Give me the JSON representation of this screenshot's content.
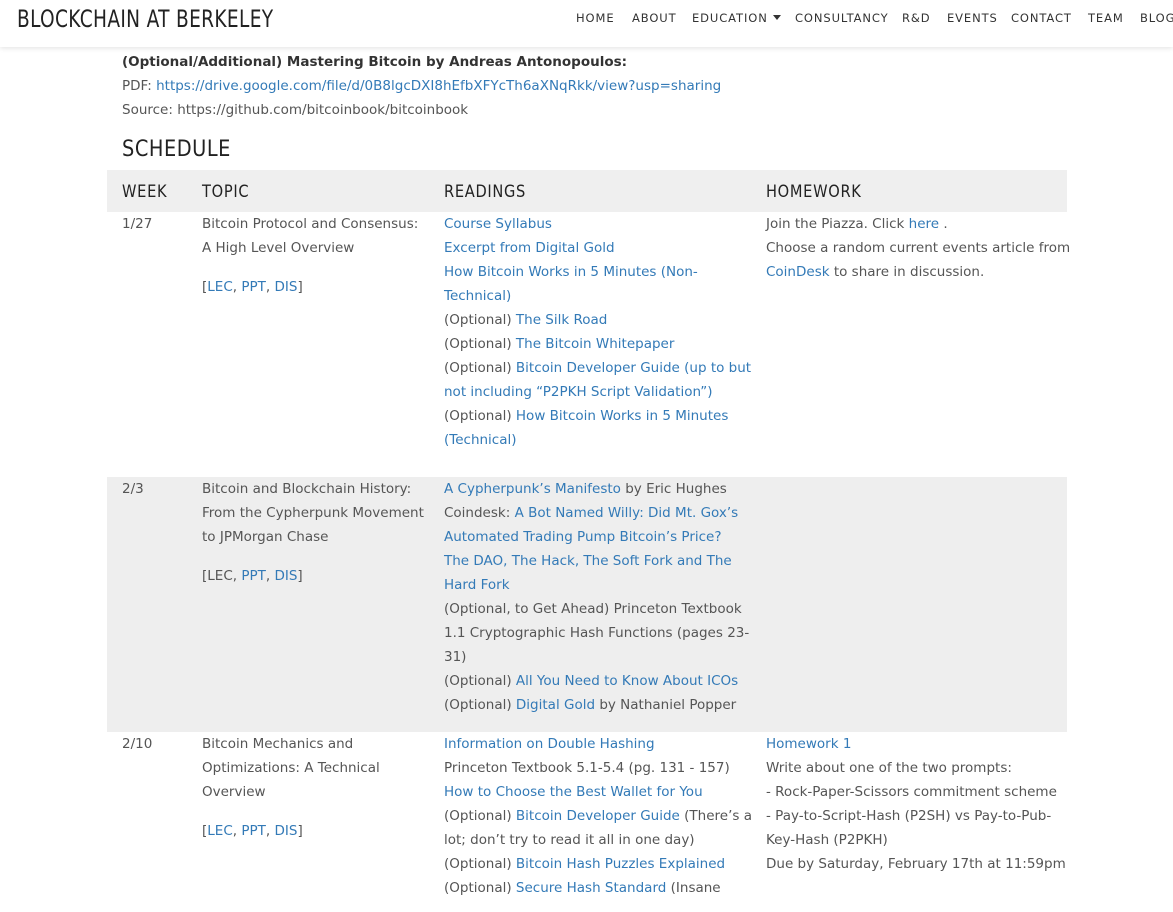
{
  "site": {
    "brand": "BLOCKCHAIN AT BERKELEY",
    "nav": [
      "HOME",
      "ABOUT",
      "EDUCATION",
      "CONSULTANCY",
      "R&D",
      "EVENTS",
      "CONTACT",
      "TEAM",
      "BLOG"
    ]
  },
  "colors": {
    "link": "#337ab7",
    "shaded_row": "#eeeeee",
    "table_header": "#efefef"
  },
  "resource": {
    "title": "(Optional/Additional) Mastering Bitcoin by Andreas Antonopoulos:",
    "pdf_label": "PDF: ",
    "pdf_url": "https://drive.google.com/file/d/0B8lgcDXI8hEfbXFYcTh6aXNqRkk/view?usp=sharing",
    "source_text": "Source: https://github.com/bitcoinbook/bitcoinbook"
  },
  "schedule": {
    "heading": "SCHEDULE",
    "columns": [
      "WEEK",
      "TOPIC",
      "READINGS",
      "HOMEWORK"
    ],
    "rows": [
      {
        "week": "1/27",
        "topic": [
          "Bitcoin Protocol and Consensus:",
          "A High Level Overview"
        ],
        "materials": {
          "open": "[",
          "lec": "LEC",
          "sep1": ", ",
          "ppt": "PPT",
          "sep2": ", ",
          "dis": "DIS",
          "close": "]"
        },
        "readings": [
          [
            {
              "t": "Course Syllabus",
              "link": true
            }
          ],
          [
            {
              "t": "Excerpt from Digital Gold",
              "link": true
            }
          ],
          [
            {
              "t": "How Bitcoin Works in 5 Minutes (Non-",
              "link": true
            }
          ],
          [
            {
              "t": "Technical)",
              "link": true
            }
          ],
          [
            {
              "t": "(Optional) ",
              "link": false
            },
            {
              "t": "The Silk Road",
              "link": true
            }
          ],
          [
            {
              "t": "(Optional) ",
              "link": false
            },
            {
              "t": "The Bitcoin Whitepaper",
              "link": true
            }
          ],
          [
            {
              "t": "(Optional) ",
              "link": false
            },
            {
              "t": "Bitcoin Developer Guide (up to but",
              "link": true
            }
          ],
          [
            {
              "t": "not including “P2PKH Script Validation”)",
              "link": true
            }
          ],
          [
            {
              "t": "(Optional) ",
              "link": false
            },
            {
              "t": "How Bitcoin Works in 5 Minutes",
              "link": true
            }
          ],
          [
            {
              "t": "(Technical)",
              "link": true
            }
          ]
        ],
        "homework": [
          [
            {
              "t": "Join the Piazza. Click ",
              "link": false
            },
            {
              "t": "here",
              "link": true
            },
            {
              "t": " .",
              "link": false
            }
          ],
          [
            {
              "t": "Choose a random current events article from",
              "link": false
            }
          ],
          [
            {
              "t": "CoinDesk",
              "link": true
            },
            {
              "t": " to share in discussion.",
              "link": false
            }
          ]
        ]
      },
      {
        "week": "2/3",
        "topic": [
          "Bitcoin and Blockchain History:",
          "From the Cypherpunk Movement",
          "to JPMorgan Chase"
        ],
        "materials": {
          "open": "[LEC, ",
          "lec": "",
          "sep1": "",
          "ppt": "PPT",
          "sep2": ", ",
          "dis": "DIS",
          "close": "]"
        },
        "readings": [
          [
            {
              "t": "A Cypherpunk’s Manifesto",
              "link": true
            },
            {
              "t": " by Eric Hughes",
              "link": false
            }
          ],
          [
            {
              "t": "Coindesk: ",
              "link": false
            },
            {
              "t": "A Bot Named Willy: Did Mt. Gox’s",
              "link": true
            }
          ],
          [
            {
              "t": "Automated Trading Pump Bitcoin’s Price?",
              "link": true
            }
          ],
          [
            {
              "t": "The DAO, The Hack, The Soft Fork and The",
              "link": true
            }
          ],
          [
            {
              "t": "Hard Fork",
              "link": true
            }
          ],
          [
            {
              "t": "(Optional, to Get Ahead) Princeton Textbook",
              "link": false
            }
          ],
          [
            {
              "t": "1.1 Cryptographic Hash Functions (pages 23-",
              "link": false
            }
          ],
          [
            {
              "t": "31)",
              "link": false
            }
          ],
          [
            {
              "t": "(Optional) ",
              "link": false
            },
            {
              "t": "All You Need to Know About ICOs",
              "link": true
            }
          ],
          [
            {
              "t": "(Optional) ",
              "link": false
            },
            {
              "t": "Digital Gold",
              "link": true
            },
            {
              "t": " by Nathaniel Popper",
              "link": false
            }
          ]
        ],
        "homework": []
      },
      {
        "week": "2/10",
        "topic": [
          "Bitcoin Mechanics and",
          "Optimizations: A Technical",
          "Overview"
        ],
        "materials": {
          "open": "[",
          "lec": "LEC",
          "sep1": ", ",
          "ppt": "PPT",
          "sep2": ", ",
          "dis": "DIS",
          "close": "]"
        },
        "readings": [
          [
            {
              "t": "Information on Double Hashing",
              "link": true
            }
          ],
          [
            {
              "t": "Princeton Textbook 5.1-5.4 (pg. 131 - 157)",
              "link": false
            }
          ],
          [
            {
              "t": "How to Choose the Best Wallet for You",
              "link": true
            }
          ],
          [
            {
              "t": "(Optional) ",
              "link": false
            },
            {
              "t": "Bitcoin Developer Guide",
              "link": true
            },
            {
              "t": " (There’s a",
              "link": false
            }
          ],
          [
            {
              "t": "lot; don’t try to read it all in one day)",
              "link": false
            }
          ],
          [
            {
              "t": "(Optional) ",
              "link": false
            },
            {
              "t": "Bitcoin Hash Puzzles Explained",
              "link": true
            }
          ],
          [
            {
              "t": "(Optional) ",
              "link": false
            },
            {
              "t": "Secure Hash Standard",
              "link": true
            },
            {
              "t": " (Insane",
              "link": false
            }
          ]
        ],
        "homework": [
          [
            {
              "t": "Homework 1",
              "link": true
            }
          ],
          [
            {
              "t": "Write about one of the two prompts:",
              "link": false
            }
          ],
          [
            {
              "t": "- Rock-Paper-Scissors commitment scheme",
              "link": false
            }
          ],
          [
            {
              "t": "- Pay-to-Script-Hash (P2SH) vs Pay-to-Pub-",
              "link": false
            }
          ],
          [
            {
              "t": "Key-Hash (P2PKH)",
              "link": false
            }
          ],
          [
            {
              "t": "Due by Saturday, February 17th at 11:59pm",
              "link": false
            }
          ]
        ]
      }
    ]
  }
}
